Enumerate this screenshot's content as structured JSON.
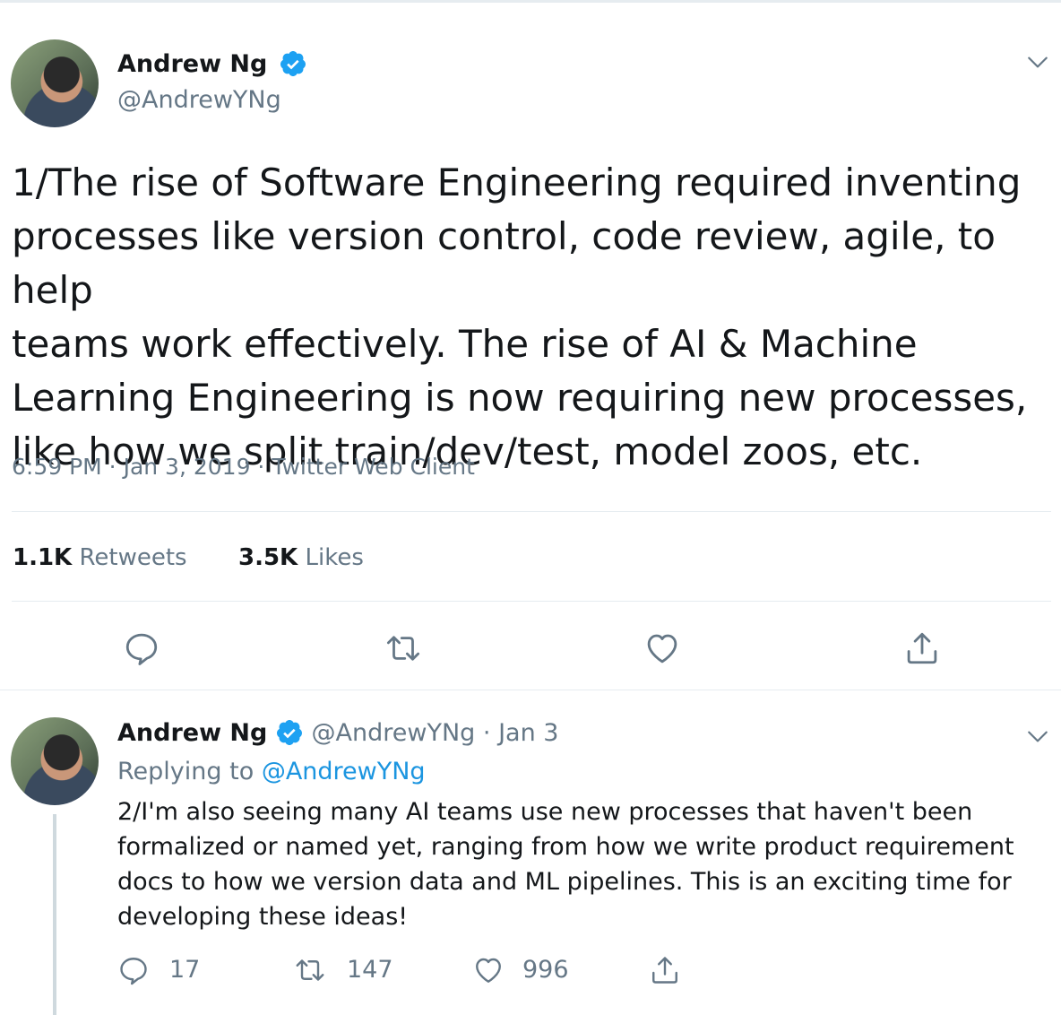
{
  "main_tweet": {
    "author_name": "Andrew Ng",
    "author_handle": "@AndrewYNg",
    "text_lines": [
      "1/The rise of Software Engineering required inventing",
      "processes like version control, code review, agile, to help",
      "teams work effectively. The rise of AI & Machine",
      "Learning Engineering is now requiring new processes,",
      "like how we split train/dev/test, model zoos, etc."
    ],
    "meta": "6:59 PM · Jan 3, 2019 · Twitter Web Client",
    "retweets_count": "1.1K",
    "retweets_label": "Retweets",
    "likes_count": "3.5K",
    "likes_label": "Likes",
    "icons": [
      "reply-icon",
      "retweet-icon",
      "like-icon",
      "share-icon",
      "chevron-down-icon",
      "verified-badge-icon"
    ]
  },
  "reply_tweet": {
    "author_name": "Andrew Ng",
    "author_handle": "@AndrewYNg",
    "dot": "·",
    "date": "Jan 3",
    "replying_label": "Replying to",
    "replying_to": "@AndrewYNg",
    "text_lines": [
      "2/I'm also seeing many AI teams use new processes that haven't been",
      "formalized or named yet, ranging from how we write product requirement",
      "docs to how we version data and ML pipelines. This is an exciting time for",
      "developing these ideas!"
    ],
    "reply_count": "17",
    "retweet_count": "147",
    "like_count": "996"
  },
  "colors": {
    "verified": "#1da1f2",
    "link": "#1b95e0",
    "muted": "#657786",
    "divider": "#e6ecf0"
  }
}
